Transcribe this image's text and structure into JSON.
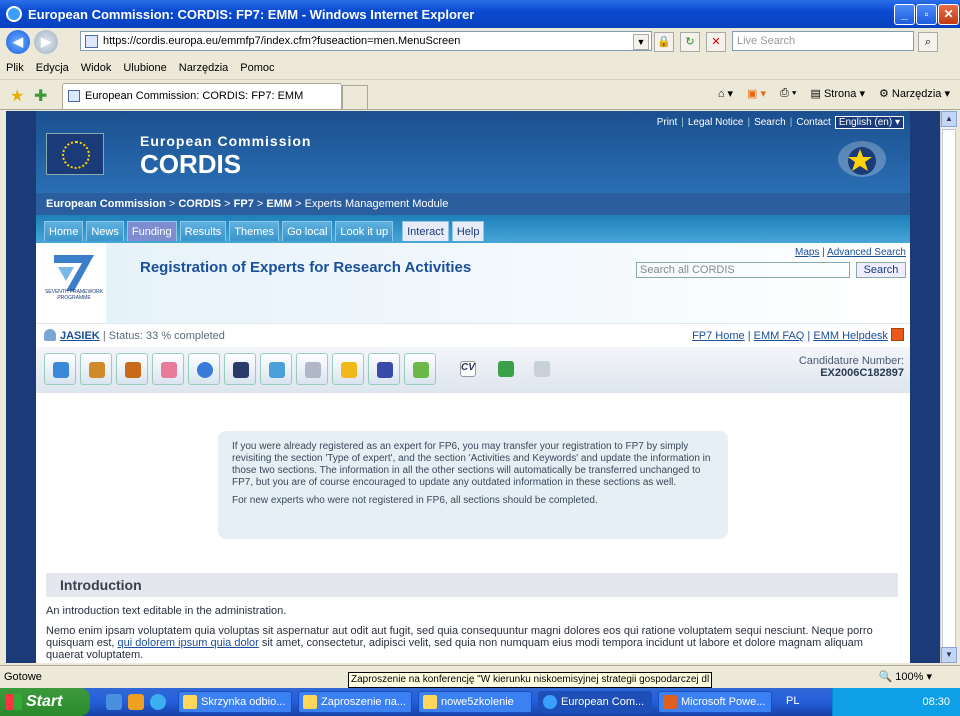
{
  "window": {
    "title": "European Commission: CORDIS: FP7: EMM - Windows Internet Explorer"
  },
  "address": {
    "url": "https://cordis.europa.eu/emmfp7/index.cfm?fuseaction=men.MenuScreen",
    "search_placeholder": "Live Search"
  },
  "menu": [
    "Plik",
    "Edycja",
    "Widok",
    "Ulubione",
    "Narzędzia",
    "Pomoc"
  ],
  "tab": {
    "title": "European Commission: CORDIS: FP7: EMM"
  },
  "commands": {
    "page": "Strona",
    "tools": "Narzędzia"
  },
  "site": {
    "toplinks": [
      "Print",
      "Legal Notice",
      "Search",
      "Contact"
    ],
    "language": "English (en)",
    "org_line1": "European Commission",
    "org_line2": "CORDIS",
    "breadcrumb": [
      "European Commission",
      "CORDIS",
      "FP7",
      "EMM",
      "Experts Management Module"
    ],
    "nav": [
      "Home",
      "News",
      "Funding",
      "Results",
      "Themes",
      "Go local",
      "Look it up",
      "Interact",
      "Help"
    ],
    "banner_title": "Registration of Experts for Research Activities",
    "fp7_caption": "SEVENTH FRAMEWORK PROGRAMME",
    "maps_link": "Maps",
    "adv_search_link": "Advanced Search",
    "search_placeholder": "Search all CORDIS",
    "search_button": "Search",
    "user_name": "JASIEK",
    "user_status": "| Status: 33 % completed",
    "user_links": [
      "FP7 Home",
      "EMM FAQ",
      "EMM Helpdesk"
    ],
    "candidature_label": "Candidature Number:",
    "candidature_number": "EX2006C182897",
    "note_p1": "If you were already registered as an expert for FP6, you may transfer your registration to FP7 by simply revisiting the section 'Type of expert', and the section 'Activities and Keywords' and update the information in those two sections. The information in all the other sections will automatically be transferred unchanged to FP7, but you are of course encouraged to update any outdated information in these sections as well.",
    "note_p2": "For new experts who were not registered in FP6, all sections should be completed.",
    "intro_title": "Introduction",
    "intro_text1": "An introduction text editable in the administration.",
    "intro_text2a": "Nemo enim ipsam voluptatem quia voluptas sit aspernatur aut odit aut fugit, sed quia consequuntur magni dolores eos qui ratione voluptatem sequi nesciunt. Neque porro quisquam est, ",
    "intro_link": "qui dolorem ipsum quia dolor",
    "intro_text2b": " sit amet, consectetur, adipisci velit, sed quia non numquam eius modi tempora incidunt ut labore et dolore magnam aliquam quaerat voluptatem."
  },
  "status": {
    "text": "Gotowe",
    "tooltip": "Zaproszenie na konferencję \"W kierunku niskoemisyjnej strategii gospodarczej dl",
    "zoom": "100%"
  },
  "taskbar": {
    "start": "Start",
    "tasks": [
      "Skrzynka odbio...",
      "Zaproszenie na...",
      "nowe5zkolenie",
      "European Com...",
      "Microsoft Powe..."
    ],
    "lang": "PL",
    "time": "08:30"
  }
}
